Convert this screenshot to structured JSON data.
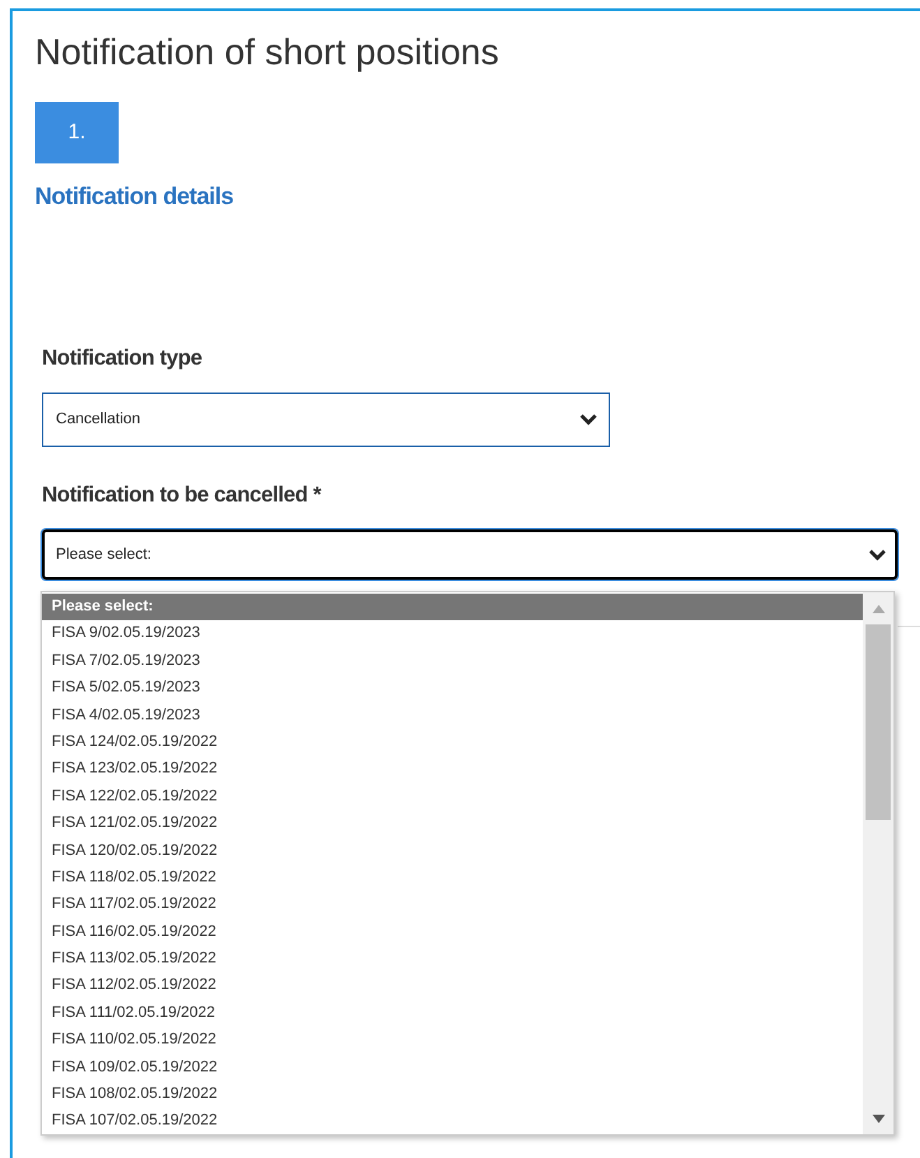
{
  "title": "Notification of short positions",
  "steps": [
    {
      "label": "1.",
      "selected": true
    }
  ],
  "step_title": "Notification details",
  "fields": [
    {
      "label": "Notification type",
      "value": "Cancellation",
      "focused": false
    },
    {
      "label": "Notification to be cancelled *",
      "value": "Please select:",
      "focused": true
    }
  ],
  "dropdown": {
    "options": [
      {
        "label": "Please select:",
        "selected": true
      },
      {
        "label": "FISA 9/02.05.19/2023",
        "selected": false
      },
      {
        "label": "FISA 7/02.05.19/2023",
        "selected": false
      },
      {
        "label": "FISA 5/02.05.19/2023",
        "selected": false
      },
      {
        "label": "FISA 4/02.05.19/2023",
        "selected": false
      },
      {
        "label": "FISA 124/02.05.19/2022",
        "selected": false
      },
      {
        "label": "FISA 123/02.05.19/2022",
        "selected": false
      },
      {
        "label": "FISA 122/02.05.19/2022",
        "selected": false
      },
      {
        "label": "FISA 121/02.05.19/2022",
        "selected": false
      },
      {
        "label": "FISA 120/02.05.19/2022",
        "selected": false
      },
      {
        "label": "FISA 118/02.05.19/2022",
        "selected": false
      },
      {
        "label": "FISA 117/02.05.19/2022",
        "selected": false
      },
      {
        "label": "FISA 116/02.05.19/2022",
        "selected": false
      },
      {
        "label": "FISA 113/02.05.19/2022",
        "selected": false
      },
      {
        "label": "FISA 112/02.05.19/2022",
        "selected": false
      },
      {
        "label": "FISA 111/02.05.19/2022",
        "selected": false
      },
      {
        "label": "FISA 110/02.05.19/2022",
        "selected": false
      },
      {
        "label": "FISA 109/02.05.19/2022",
        "selected": false
      },
      {
        "label": "FISA 108/02.05.19/2022",
        "selected": false
      },
      {
        "label": "FISA 107/02.05.19/2022",
        "selected": false
      }
    ]
  }
}
